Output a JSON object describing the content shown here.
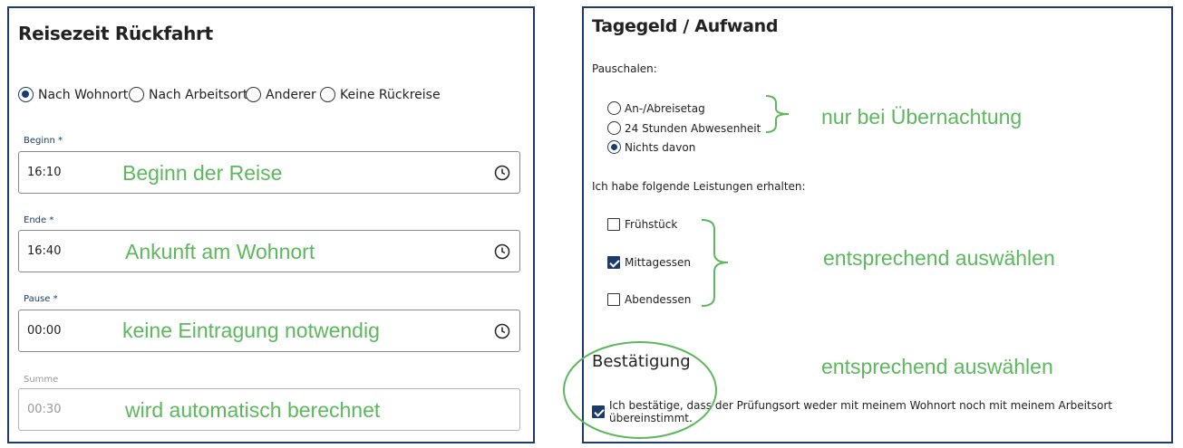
{
  "left": {
    "title": "Reisezeit Rückfahrt",
    "radios": [
      {
        "label": "Nach Wohnort",
        "checked": true
      },
      {
        "label": "Nach Arbeitsort",
        "checked": false
      },
      {
        "label": "Anderer",
        "checked": false
      },
      {
        "label": "Keine Rückreise",
        "checked": false
      }
    ],
    "fields": {
      "begin": {
        "label": "Beginn *",
        "value": "16:10",
        "icon": "clock-icon"
      },
      "end": {
        "label": "Ende *",
        "value": "16:40",
        "icon": "clock-icon"
      },
      "pause": {
        "label": "Pause *",
        "value": "00:00",
        "icon": "clock-icon"
      },
      "sum": {
        "label": "Summe",
        "value": "00:30"
      }
    }
  },
  "right": {
    "title": "Tagegeld / Aufwand",
    "pauschalen_label": "Pauschalen:",
    "pauschalen": [
      {
        "label": "An-/Abreisetag",
        "checked": false
      },
      {
        "label": "24 Stunden Abwesenheit",
        "checked": false
      },
      {
        "label": "Nichts davon",
        "checked": true
      }
    ],
    "leistungen_label": "Ich habe folgende Leistungen erhalten:",
    "leistungen": [
      {
        "label": "Frühstück",
        "checked": false
      },
      {
        "label": "Mittagessen",
        "checked": true
      },
      {
        "label": "Abendessen",
        "checked": false
      }
    ],
    "confirmation_title": "Bestätigung",
    "confirmation_text": "Ich bestätige, dass der Prüfungsort weder mit meinem Wohnort noch mit meinem Arbeitsort übereinstimmt.",
    "confirmation_checked": true
  },
  "annotations": {
    "begin": "Beginn der Reise",
    "end": "Ankunft am Wohnort",
    "pause": "keine Eintragung notwendig",
    "sum": "wird automatisch berechnet",
    "pauschalen": "nur bei Übernachtung",
    "leistungen": "entsprechend auswählen",
    "confirmation": "entsprechend auswählen"
  },
  "colors": {
    "accent": "#1c3b6a",
    "annotation": "#5cb85c"
  }
}
